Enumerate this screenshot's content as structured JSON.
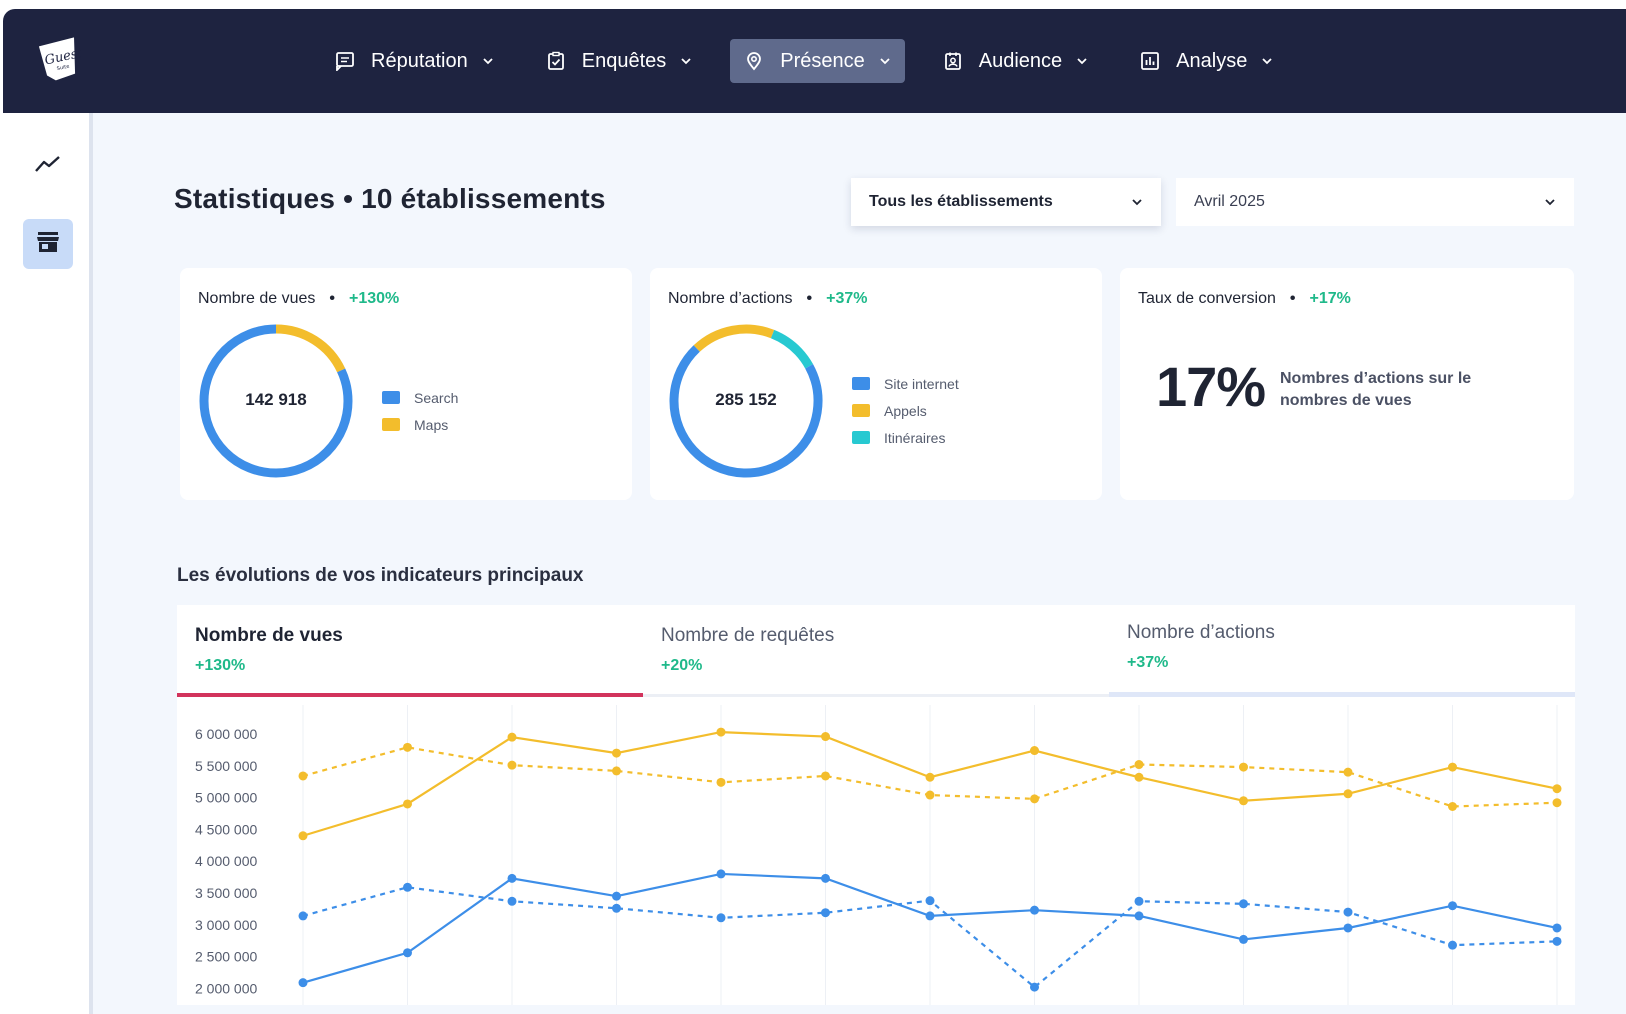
{
  "nav": {
    "items": [
      {
        "label": "Réputation",
        "icon": "message-square-icon",
        "active": false
      },
      {
        "label": "Enquêtes",
        "icon": "clipboard-check-icon",
        "active": false
      },
      {
        "label": "Présence",
        "icon": "map-pin-icon",
        "active": true
      },
      {
        "label": "Audience",
        "icon": "id-badge-icon",
        "active": false
      },
      {
        "label": "Analyse",
        "icon": "bar-chart-icon",
        "active": false
      }
    ]
  },
  "logo": {
    "icon": "guest-suite-logo",
    "text": "Guest Suite"
  },
  "sidebar": {
    "items": [
      {
        "icon": "trend-line-icon",
        "active": false
      },
      {
        "icon": "store-icon",
        "active": true
      }
    ]
  },
  "header": {
    "title": "Statistiques • 10 établissements",
    "establishment_select": "Tous les établissements",
    "period_select": "Avril 2025"
  },
  "cards": {
    "views": {
      "label": "Nombre de vues",
      "change": "+130%",
      "total": "142 918",
      "legend": [
        {
          "label": "Search",
          "color": "#3d8ee8"
        },
        {
          "label": "Maps",
          "color": "#f3bd2c"
        }
      ],
      "share": [
        0.82,
        0.18
      ]
    },
    "actions": {
      "label": "Nombre d’actions",
      "change": "+37%",
      "total": "285 152",
      "legend": [
        {
          "label": "Site internet",
          "color": "#3d8ee8"
        },
        {
          "label": "Appels",
          "color": "#f3bd2c"
        },
        {
          "label": "Itinéraires",
          "color": "#27c9d1"
        }
      ],
      "share": [
        0.71,
        0.18,
        0.11
      ]
    },
    "conversion": {
      "label": "Taux de conversion",
      "change": "+17%",
      "value": "17%",
      "description": "Nombres d’actions sur le nombres de vues"
    }
  },
  "section_title": "Les évolutions de vos indicateurs principaux",
  "tabs": [
    {
      "label": "Nombre de vues",
      "change": "+130%",
      "active": true
    },
    {
      "label": "Nombre de requêtes",
      "change": "+20%",
      "active": false
    },
    {
      "label": "Nombre d’actions",
      "change": "+37%",
      "active": false
    }
  ],
  "colors": {
    "accent_blue": "#3d8ee8",
    "accent_yellow": "#f3bd2c",
    "positive": "#1fb98a",
    "tab_active": "#d2335c",
    "nav_bg": "#1e2340"
  },
  "chart_data": {
    "type": "line",
    "ylim": [
      1500000,
      6000000
    ],
    "y_ticks": [
      "6 000 000",
      "5 500 000",
      "5 000 000",
      "4 500 000",
      "4 000 000",
      "3 500 000",
      "3 000 000",
      "2 500 000",
      "2 000 000"
    ],
    "y_tick_values": [
      6000000,
      5500000,
      5000000,
      4500000,
      4000000,
      3500000,
      3000000,
      2500000,
      2000000
    ],
    "points": 13,
    "grid": "vertical",
    "series": [
      {
        "color": "#f3bd2c",
        "style": "solid",
        "values": [
          4400000,
          4900000,
          5950000,
          5700000,
          6030000,
          5960000,
          5320000,
          5740000,
          5320000,
          4950000,
          5060000,
          5480000,
          5140000
        ]
      },
      {
        "color": "#f3bd2c",
        "style": "dashed",
        "values": [
          5340000,
          5790000,
          5510000,
          5420000,
          5240000,
          5340000,
          5040000,
          4980000,
          5520000,
          5480000,
          5400000,
          4860000,
          4920000
        ]
      },
      {
        "color": "#3d8ee8",
        "style": "solid",
        "values": [
          2090000,
          2560000,
          3730000,
          3450000,
          3800000,
          3730000,
          3140000,
          3230000,
          3140000,
          2770000,
          2950000,
          3300000,
          2950000
        ]
      },
      {
        "color": "#3d8ee8",
        "style": "dashed",
        "values": [
          3140000,
          3590000,
          3370000,
          3260000,
          3110000,
          3190000,
          3380000,
          2020000,
          3370000,
          3330000,
          3200000,
          2680000,
          2740000
        ]
      }
    ]
  }
}
